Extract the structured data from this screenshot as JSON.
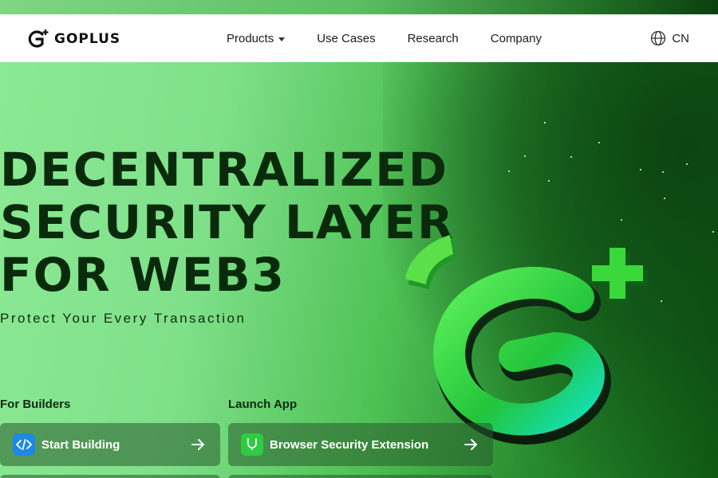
{
  "brand": {
    "name": "GOPLUS"
  },
  "nav": {
    "items": [
      {
        "label": "Products",
        "has_dropdown": true
      },
      {
        "label": "Use Cases"
      },
      {
        "label": "Research"
      },
      {
        "label": "Company"
      }
    ],
    "language": "CN"
  },
  "hero": {
    "headline_lines": [
      "DECENTRALIZED",
      "SECURITY LAYER",
      "FOR WEB3"
    ],
    "tagline": "Protect Your Every Transaction"
  },
  "sections": {
    "builders": {
      "label": "For Builders",
      "button": {
        "label": "Start Building",
        "icon": "code-icon"
      }
    },
    "launch_app": {
      "label": "Launch App",
      "button": {
        "label": "Browser Security Extension",
        "icon": "shield-stethoscope-icon"
      }
    }
  },
  "colors": {
    "accent": "#2ecc40",
    "headline": "#0a2a0c",
    "button_bg": "#3d6b40",
    "code_icon_bg": "#1e88e5",
    "extension_icon_bg": "#2ecc40"
  }
}
